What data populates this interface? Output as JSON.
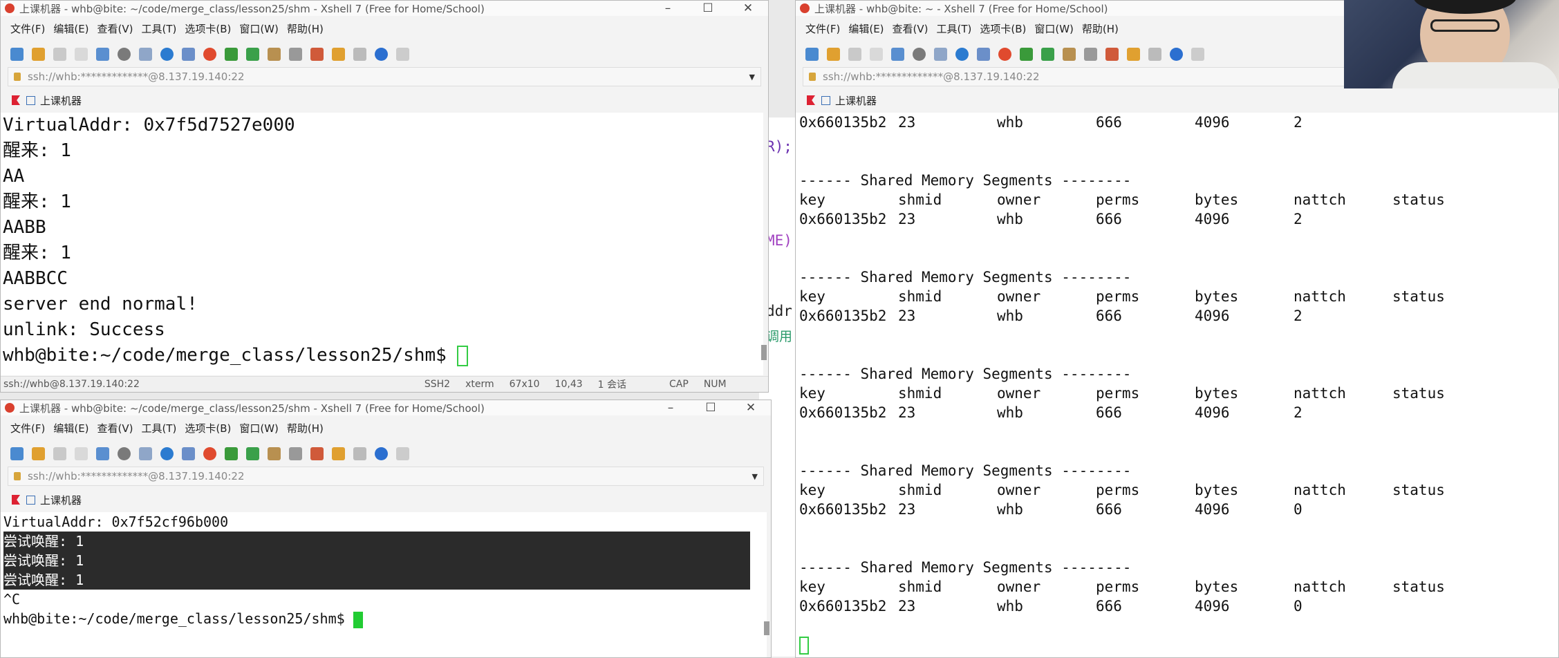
{
  "left_top": {
    "title": "上课机器 - whb@bite: ~/code/merge_class/lesson25/shm - Xshell 7 (Free for Home/School)",
    "menu": [
      "文件(F)",
      "编辑(E)",
      "查看(V)",
      "工具(T)",
      "选项卡(B)",
      "窗口(W)",
      "帮助(H)"
    ],
    "address": "ssh://whb:*************@8.137.19.140:22",
    "tab_label": "上课机器",
    "lines": [
      "VirtualAddr: 0x7f5d7527e000",
      "醒来: 1",
      "AA",
      "醒来: 1",
      "AABB",
      "醒来: 1",
      "AABBCC",
      "server end normal!",
      "unlink: Success"
    ],
    "prompt": "whb@bite:~/code/merge_class/lesson25/shm$ ",
    "status": [
      "ssh://whb@8.137.19.140:22",
      "SSH2",
      "xterm",
      "67x10",
      "10,43",
      "1 会话",
      "CAP",
      "NUM"
    ]
  },
  "left_bottom": {
    "title": "上课机器 - whb@bite: ~/code/merge_class/lesson25/shm - Xshell 7 (Free for Home/School)",
    "menu": [
      "文件(F)",
      "编辑(E)",
      "查看(V)",
      "工具(T)",
      "选项卡(B)",
      "窗口(W)",
      "帮助(H)"
    ],
    "address": "ssh://whb:*************@8.137.19.140:22",
    "tab_label": "上课机器",
    "lines": [
      "VirtualAddr: 0x7f52cf96b000"
    ],
    "highlighted": [
      "尝试唤醒: 1",
      "尝试唤醒: 1",
      "尝试唤醒: 1"
    ],
    "ctrl_c": "^C",
    "prompt": "whb@bite:~/code/merge_class/lesson25/shm$ "
  },
  "right": {
    "title": "上课机器 - whb@bite: ~ - Xshell 7 (Free for Home/School)",
    "menu": [
      "文件(F)",
      "编辑(E)",
      "查看(V)",
      "工具(T)",
      "选项卡(B)",
      "窗口(W)",
      "帮助(H)"
    ],
    "address": "ssh://whb:*************@8.137.19.140:22",
    "tab_label": "上课机器",
    "first_row": [
      "0x660135b2",
      "23",
      "whb",
      "666",
      "4096",
      "2"
    ],
    "segment_header": "------ Shared Memory Segments --------",
    "columns": [
      "key",
      "shmid",
      "owner",
      "perms",
      "bytes",
      "nattch",
      "status"
    ],
    "segments": [
      [
        "0x660135b2",
        "23",
        "whb",
        "666",
        "4096",
        "2"
      ],
      [
        "0x660135b2",
        "23",
        "whb",
        "666",
        "4096",
        "2"
      ],
      [
        "0x660135b2",
        "23",
        "whb",
        "666",
        "4096",
        "2"
      ],
      [
        "0x660135b2",
        "23",
        "whb",
        "666",
        "4096",
        "0"
      ],
      [
        "0x660135b2",
        "23",
        "whb",
        "666",
        "4096",
        "0"
      ]
    ]
  },
  "bg_fragments": [
    "R);",
    "ME)",
    "ddr",
    "调用"
  ]
}
